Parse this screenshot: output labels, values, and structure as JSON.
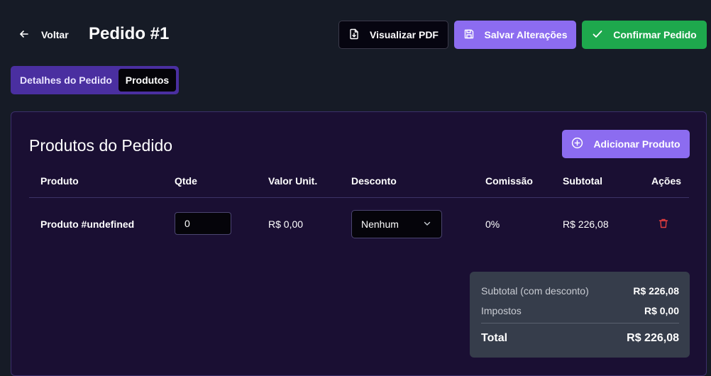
{
  "header": {
    "back_label": "Voltar",
    "title": "Pedido #1",
    "pdf_label": "Visualizar PDF",
    "save_label": "Salvar Alterações",
    "confirm_label": "Confirmar Pedido"
  },
  "tabs": [
    {
      "label": "Detalhes do Pedido",
      "active": false
    },
    {
      "label": "Produtos",
      "active": true
    }
  ],
  "products": {
    "title": "Produtos do Pedido",
    "add_label": "Adicionar Produto",
    "columns": [
      "Produto",
      "Qtde",
      "Valor Unit.",
      "Desconto",
      "Comissão",
      "Subtotal",
      "Ações"
    ],
    "rows": [
      {
        "product": "Produto #undefined",
        "qty": "0",
        "unit_price": "R$ 0,00",
        "discount": "Nenhum",
        "commission": "0%",
        "subtotal": "R$ 226,08"
      }
    ]
  },
  "summary": {
    "subtotal_label": "Subtotal (com desconto)",
    "subtotal_value": "R$ 226,08",
    "taxes_label": "Impostos",
    "taxes_value": "R$ 0,00",
    "total_label": "Total",
    "total_value": "R$ 226,08"
  },
  "colors": {
    "background": "#161b26",
    "panel": "#1a0f33",
    "accent_purple": "#8c6cf0",
    "success_green": "#1ea84d",
    "danger_red": "#e53e3e"
  }
}
